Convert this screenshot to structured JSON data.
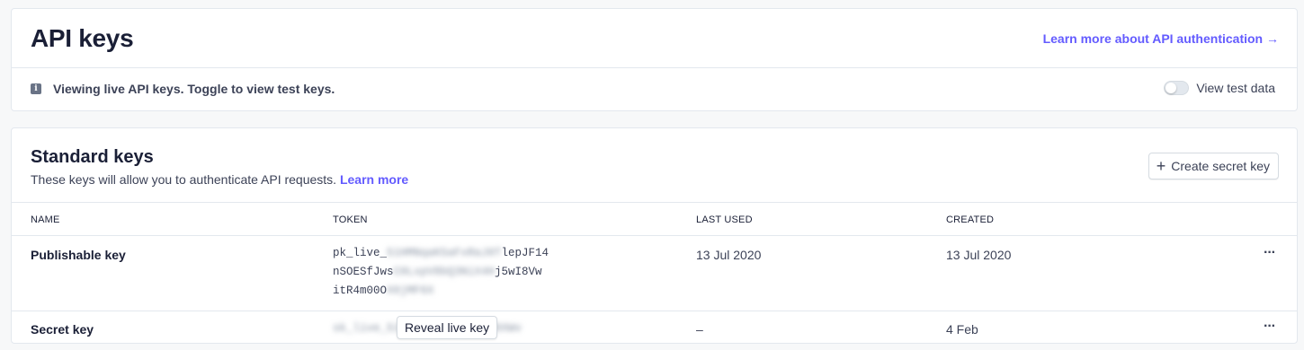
{
  "header": {
    "title": "API keys",
    "learn_link": "Learn more about API authentication →"
  },
  "info": {
    "icon": "info-icon",
    "text": "Viewing live API keys. Toggle to view test keys.",
    "toggle_label": "View test data",
    "toggle_on": false
  },
  "standard_keys": {
    "title": "Standard keys",
    "description": "These keys will allow you to authenticate API requests.",
    "learn_more": "Learn more",
    "create_button": "Create secret key",
    "columns": [
      "NAME",
      "TOKEN",
      "LAST USED",
      "CREATED"
    ],
    "rows": [
      {
        "name": "Publishable key",
        "token_lines": [
          {
            "visible_start": "pk_live_",
            "hidden": "51HMNqaK5aFxRaJ0T",
            "visible_end": "lepJF14"
          },
          {
            "visible_start": "nSOESfJws",
            "hidden": "C0LxpV8bQ3NiX4H",
            "visible_end": "j5wI8Vw"
          },
          {
            "visible_start": "itR4m00O",
            "hidden": "X0jMF6X",
            "visible_end": ""
          }
        ],
        "last_used": "13 Jul 2020",
        "created": "13 Jul 2020"
      },
      {
        "name": "Secret key",
        "token_hidden": "sk_live_51HMNqaK5aFxRa0J0XWv",
        "reveal_button": "Reveal live key",
        "last_used": "–",
        "created": "4 Feb"
      }
    ],
    "more_icon": "···"
  },
  "colors": {
    "accent": "#635bff",
    "text": "#1a1f36",
    "muted": "#3c4257",
    "border": "#e3e8ee"
  }
}
